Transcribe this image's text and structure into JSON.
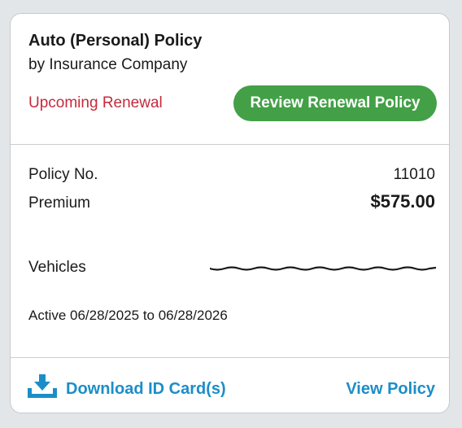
{
  "policy": {
    "title": "Auto (Personal) Policy",
    "company": "by Insurance Company",
    "status": "Upcoming Renewal",
    "review_button_label": "Review Renewal Policy"
  },
  "details": {
    "policy_no_label": "Policy No.",
    "policy_no_value": "11010",
    "premium_label": "Premium",
    "premium_value": "$575.00",
    "vehicles_label": "Vehicles",
    "active_text": "Active 06/28/2025 to 06/28/2026"
  },
  "footer": {
    "download_label": "Download ID Card(s)",
    "view_policy_label": "View Policy"
  },
  "icons": {
    "download": "download-icon"
  },
  "colors": {
    "status_red": "#c62a3c",
    "button_green": "#43a047",
    "link_blue": "#1b8ec8",
    "background": "#e3e6e8"
  }
}
